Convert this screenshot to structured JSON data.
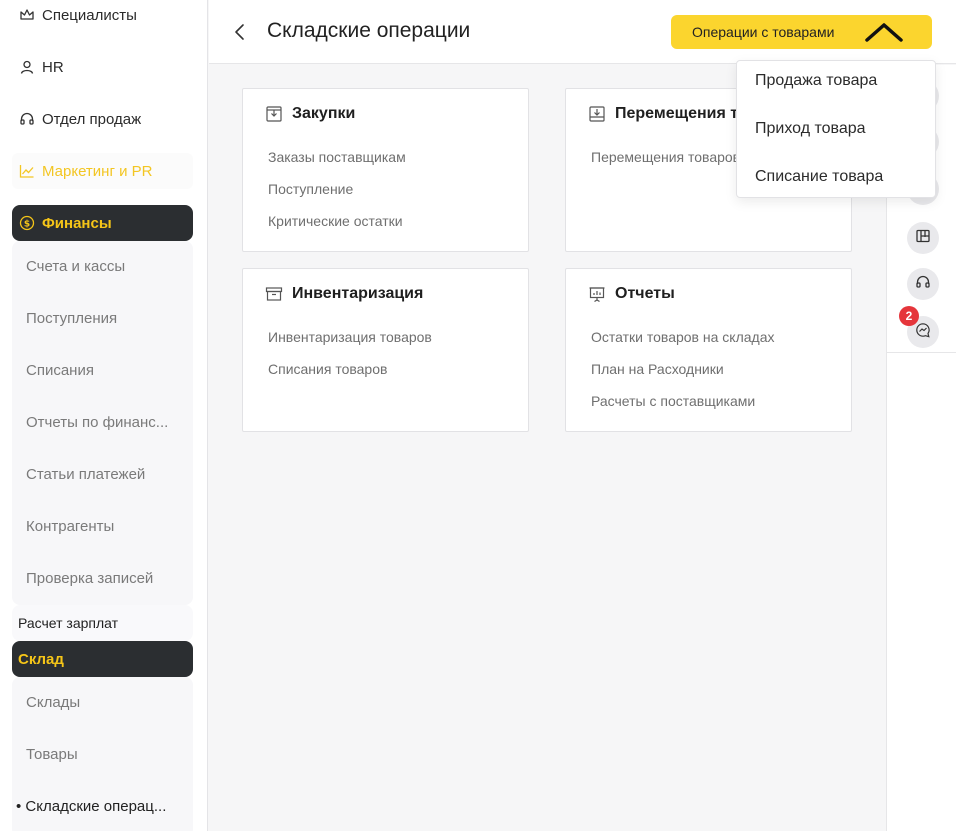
{
  "sidebar": {
    "top_items": [
      {
        "label": "Специалисты",
        "icon": "crown-icon"
      },
      {
        "label": "HR",
        "icon": "user-icon"
      },
      {
        "label": "Отдел продаж",
        "icon": "headset-icon"
      },
      {
        "label": "Маркетинг и PR",
        "icon": "chart-line-icon"
      }
    ],
    "finance": {
      "label": "Финансы",
      "icon": "dollar-circle-icon",
      "items": [
        "Счета и кассы",
        "Поступления",
        "Списания",
        "Отчеты по финанс...",
        "Статьи платежей",
        "Контрагенты",
        "Проверка записей"
      ]
    },
    "salary": "Расчет зарплат",
    "warehouse": {
      "label": "Склад",
      "items": [
        "Склады",
        "Товары"
      ],
      "current": "• Складские операц..."
    }
  },
  "header": {
    "title": "Складские операции",
    "ops_button": "Операции с товарами"
  },
  "dropdown": {
    "items": [
      "Продажа товара",
      "Приход товара",
      "Списание товара"
    ]
  },
  "cards": [
    {
      "title": "Закупки",
      "icon": "box-in-icon",
      "links": [
        "Заказы поставщикам",
        "Поступление",
        "Критические остатки"
      ]
    },
    {
      "title": "Перемещения т",
      "icon": "download-box-icon",
      "links": [
        "Перемещения товаров"
      ]
    },
    {
      "title": "Инвентаризация",
      "icon": "archive-icon",
      "links": [
        "Инвентаризация товаров",
        "Списания товаров"
      ]
    },
    {
      "title": "Отчеты",
      "icon": "presentation-icon",
      "links": [
        "Остатки товаров на складах",
        "План на Расходники",
        "Расчеты с поставщиками"
      ]
    }
  ],
  "right_strip": {
    "badge": "2"
  },
  "colors": {
    "accent": "#fbd52e",
    "active_bg": "#2b2e31",
    "active_text": "#f5c518",
    "badge": "#e5353b"
  }
}
